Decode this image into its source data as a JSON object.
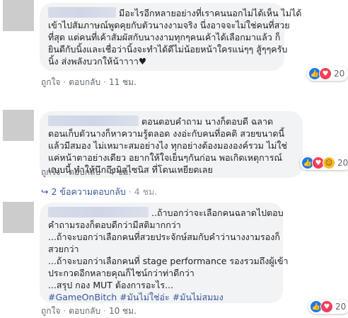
{
  "comments": [
    {
      "lines": [
        "มีอะไรอีกหลายอย่างที่เราคนนอกไม่ได้เห็น ไม่ได้",
        "เข้าไปสัมภาษณ์พูดคุยกับตัวนางงามจริง นี่งอาจจะไม่ใช่คนที่สวย",
        "ที่สุด แต่คนที่เค้าสัมผัสกับนางงามทุกๆคนเค้าได้เลือกมาแล้ว ก็",
        "ยินดีกับนิ้งและเชื่อว่านิ้งจะทำได้ดีไม่น้อยหน้าใครแน่ๆๆ สู้ๆๆครับ",
        "นิ้ง ส่งพลังบวกให้น้าาาา♥"
      ],
      "actions": {
        "like": "ถูกใจ",
        "reply": "ตอบกลับ",
        "time": "11 ชม."
      },
      "reaction_count": "20",
      "reaction_icons": [
        "like-icon",
        "love-icon"
      ]
    },
    {
      "lines": [
        "ตอนตอบคำถาม นางก็ตอบดี ฉลาด",
        "ตอนเก็บตัวนางก็หาความรู้ตลอด งงอ่ะกับคนที่อคติ สวยขนาดนี้",
        "แล้วมีสมอง ไม่เหมาะสมอย่างไง ทุกอย่างต้องมององค์รวม ไม่ใช่",
        "แค่หน้าตาอย่างเดียว อยากให้ใจเย็นๆกันก่อน พอเกิดเหตุการณ์",
        "แบบนี้ ทำให้นึกถึงมิสไซนิส ที่โดนเหยียดเลย"
      ],
      "actions": {
        "like": "ถูกใจ",
        "reply": "ตอบกลับ",
        "time": "4 ชม."
      },
      "reaction_count": "20",
      "reaction_icons": [
        "like-icon",
        "love-icon",
        "haha-icon"
      ]
    },
    {
      "lines": [
        "..ถ้าบอกว่าจะเลือกคนฉลาดไปตอบ",
        "คำถามรองก็ตอบดีกว่ามีสติมากกว่า",
        "...ถ้าจะบอกว่าเลือกคนที่สวยประจักษ์สมกับคำว่านางงามรองก็",
        "สวยกว่า",
        "...ถ้าจะบอกว่าเลือกคนที่ stage performance รองรวมถึงผู้เข้า",
        "ประกวดอีกหลายคุณก็ไชน์กว่าท่าดีกว่า",
        "...สรุป กอง MUT ต้องการอะไร...",
        "#GameOnBitch #มันไม่ใช่อ่ะ #มันไม่สมมง"
      ],
      "actions": {
        "like": "ถูกใจ",
        "reply": "ตอบกลับ",
        "time": "10 ชม."
      },
      "reaction_count": "20",
      "reaction_icons": [
        "like-icon",
        "love-icon"
      ]
    }
  ],
  "replies_link": {
    "label": "2 ข้อความตอบกลับ",
    "time": "4 ชม."
  },
  "colors": {
    "like": "#1877f2",
    "love": "#f33e58",
    "haha": "#f7b928",
    "link": "#385898"
  }
}
